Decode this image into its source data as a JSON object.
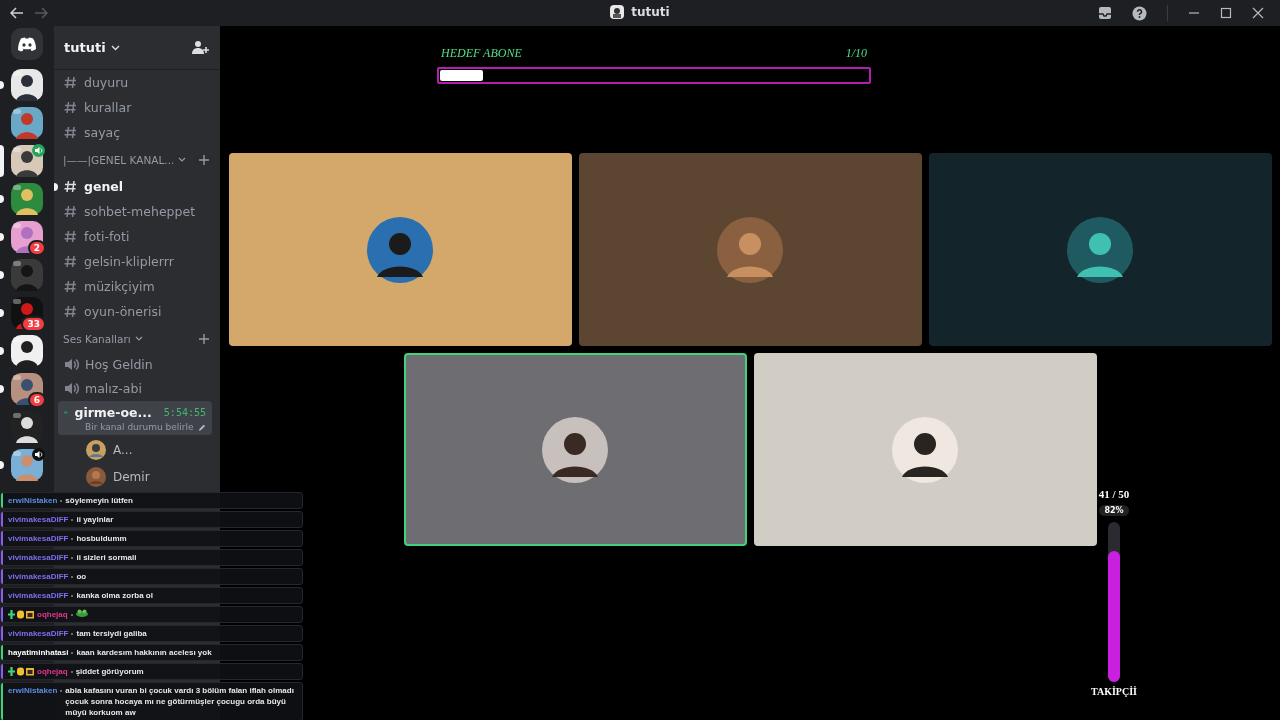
{
  "titlebar": {
    "title": "tututi"
  },
  "servers": [
    {
      "selected": false,
      "unread": true,
      "speaker": false
    },
    {
      "selected": false,
      "unread": false,
      "speaker": false
    },
    {
      "selected": true,
      "unread": false,
      "speaker": true
    },
    {
      "selected": false,
      "unread": true,
      "speaker": false
    },
    {
      "selected": false,
      "unread": true,
      "speaker": false,
      "badge": "2"
    },
    {
      "selected": false,
      "unread": true,
      "speaker": false
    },
    {
      "selected": false,
      "unread": true,
      "speaker": false,
      "badge": "33"
    },
    {
      "selected": false,
      "unread": true,
      "speaker": false
    },
    {
      "selected": false,
      "unread": true,
      "speaker": false,
      "badge": "6"
    },
    {
      "selected": false,
      "unread": false,
      "speaker": false
    },
    {
      "selected": false,
      "unread": true,
      "speaker": true
    }
  ],
  "sidebar": {
    "server_name": "tututi",
    "items": [
      {
        "kind": "text",
        "name": "duyuru",
        "selected": false,
        "unread": false
      },
      {
        "kind": "text",
        "name": "kurallar",
        "selected": false,
        "unread": false
      },
      {
        "kind": "text",
        "name": "sayaç",
        "selected": false,
        "unread": false
      },
      {
        "kind": "category",
        "name": "|——|GENEL KANAL..."
      },
      {
        "kind": "text",
        "name": "genel",
        "selected": true,
        "unread": true
      },
      {
        "kind": "text",
        "name": "sohbet-meheppet",
        "selected": false,
        "unread": false
      },
      {
        "kind": "text",
        "name": "foti-foti",
        "selected": false,
        "unread": false
      },
      {
        "kind": "text",
        "name": "gelsin-kliplerrr",
        "selected": false,
        "unread": false
      },
      {
        "kind": "text",
        "name": "müzikçiyim",
        "selected": false,
        "unread": false
      },
      {
        "kind": "text",
        "name": "oyun-önerisi",
        "selected": false,
        "unread": false
      },
      {
        "kind": "category",
        "name": "Ses Kanalları"
      },
      {
        "kind": "voice",
        "name": "Hoş Geldin",
        "selected": false
      },
      {
        "kind": "voice",
        "name": "malız-abi",
        "selected": false
      },
      {
        "kind": "voice",
        "name": "girme-oe...",
        "selected": true,
        "timer": "5:54:55",
        "status": "Bir kanal durumu belirle",
        "children": [
          {
            "name": "A..."
          },
          {
            "name": "Demir"
          }
        ]
      }
    ]
  },
  "goal": {
    "label": "HEDEF ABONE",
    "count": "1/10",
    "level": 0.1
  },
  "tiles": [
    {
      "color": "#d4a76a",
      "speaking": false
    },
    {
      "color": "#5c4631",
      "speaking": false
    },
    {
      "color": "#13242b",
      "speaking": false
    },
    {
      "color": "#6d6d72",
      "speaking": true
    },
    {
      "color": "#d1cdc4",
      "speaking": false
    }
  ],
  "meter": {
    "count": "41 / 50",
    "percent": "82%",
    "level": 0.82,
    "label": "TAKİPÇİİ"
  },
  "chat": [
    {
      "user": "erwiNistaken",
      "color": "#5a8ee6",
      "stripe": {
        "color": "#3fd47a"
      },
      "badges": false,
      "text": "söylemeyin lütfen"
    },
    {
      "user": "vivimakesaDIFF",
      "color": "#7a6ff0",
      "stripe": {
        "color": "#8a5cf0"
      },
      "badges": false,
      "text": "ii yayinlar"
    },
    {
      "user": "vivimakesaDIFF",
      "color": "#7a6ff0",
      "stripe": {
        "color": "#8a5cf0"
      },
      "badges": false,
      "text": "hosbuldumm"
    },
    {
      "user": "vivimakesaDIFF",
      "color": "#7a6ff0",
      "stripe": {
        "color": "#8a5cf0"
      },
      "badges": false,
      "text": "ii sizleri sormali"
    },
    {
      "user": "vivimakesaDIFF",
      "color": "#7a6ff0",
      "stripe": {
        "color": "#8a5cf0"
      },
      "badges": false,
      "text": "oo"
    },
    {
      "user": "vivimakesaDIFF",
      "color": "#7a6ff0",
      "stripe": {
        "color": "#8a5cf0"
      },
      "badges": false,
      "text": "kanka olma zorba ol"
    },
    {
      "user": "oqhejaq",
      "color": "#e0358f",
      "stripe": {
        "color": "#8a5cf0"
      },
      "badges": true,
      "emote": true
    },
    {
      "user": "vivimakesaDIFF",
      "color": "#7a6ff0",
      "stripe": {
        "color": "#8a5cf0"
      },
      "badges": false,
      "text": "tam tersiydi galiba"
    },
    {
      "user": "hayatiminhatasi",
      "color": "#ffffff",
      "stripe": {
        "color": "#3fd47a"
      },
      "badges": false,
      "text": "kaan kardesım hakkının acelesı yok"
    },
    {
      "user": "oqhejaq",
      "color": "#e0358f",
      "stripe": {
        "color": "#8a5cf0"
      },
      "badges": true,
      "text": "şiddet görüyorum"
    },
    {
      "user": "erwiNistaken",
      "color": "#5a8ee6",
      "stripe": {
        "color": "#3fd47a"
      },
      "badges": false,
      "text": "abla kafasını vuran bi çocuk vardı 3 bölüm falan iflah olmadı çocuk sonra hocaya mı ne götürmüşler çocugu orda büyü müyü korkuom aw"
    }
  ]
}
